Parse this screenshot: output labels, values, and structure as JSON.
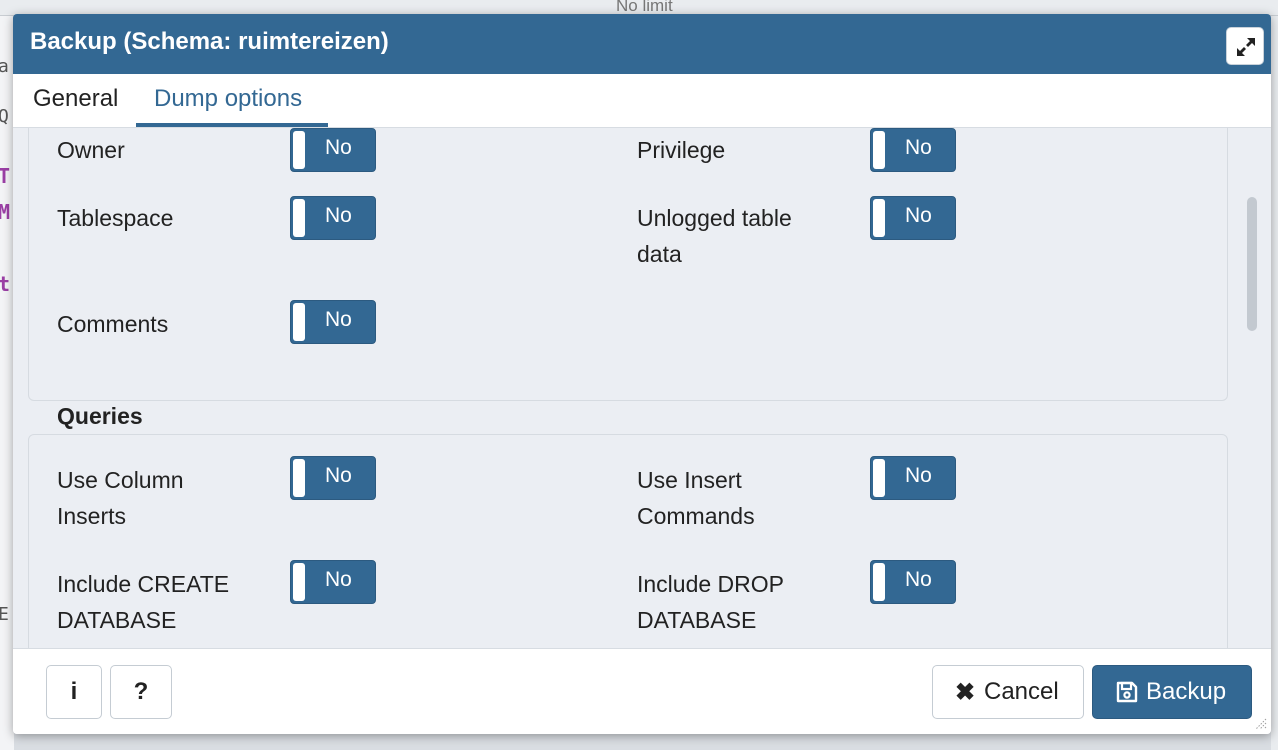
{
  "background": {
    "toolbar_text": "No limit",
    "code_glyphs": [
      "T",
      "M",
      "t"
    ],
    "side_glyphs": [
      "a",
      "Q",
      "E"
    ]
  },
  "dialog": {
    "title": "Backup (Schema: ruimtereizen)",
    "tabs": [
      {
        "label": "General",
        "active": false
      },
      {
        "label": "Dump options",
        "active": true
      }
    ]
  },
  "fieldset1": {
    "options": [
      {
        "label": "Owner",
        "value": "No"
      },
      {
        "label": "Privilege",
        "value": "No"
      },
      {
        "label": "Tablespace",
        "value": "No"
      },
      {
        "label": "Unlogged table data",
        "value": "No"
      },
      {
        "label": "Comments",
        "value": "No"
      }
    ]
  },
  "queries": {
    "legend": "Queries",
    "options": [
      {
        "label": "Use Column Inserts",
        "value": "No"
      },
      {
        "label": "Use Insert Commands",
        "value": "No"
      },
      {
        "label": "Include CREATE DATABASE",
        "value": "No"
      },
      {
        "label": "Include DROP DATABASE",
        "value": "No"
      }
    ]
  },
  "footer": {
    "info_label": "i",
    "help_label": "?",
    "cancel_label": "Cancel",
    "cancel_icon": "✖",
    "backup_label": "Backup"
  },
  "colors": {
    "primary": "#336893",
    "panel": "#ebeef3"
  }
}
